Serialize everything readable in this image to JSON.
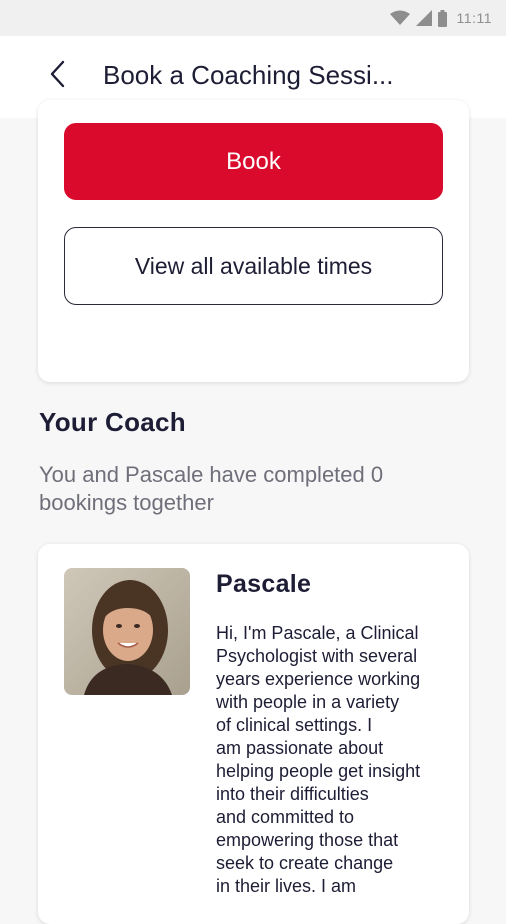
{
  "status_bar": {
    "time": "11:11",
    "icons": [
      "wifi-icon",
      "cell-signal-icon",
      "battery-icon"
    ]
  },
  "header": {
    "back_icon": "chevron-left-icon",
    "title": "Book a Coaching Sessi..."
  },
  "booking_card": {
    "book_label": "Book",
    "view_times_label": "View all available times"
  },
  "coach_section": {
    "title": "Your Coach",
    "bookings_summary": "You and Pascale have completed 0 bookings together"
  },
  "coach": {
    "name": "Pascale",
    "photo": "coach-photo",
    "bio": " Hi, I'm Pascale, a Clinical\nPsychologist with several\nyears experience working\nwith people in a variety\nof clinical settings. I\nam passionate about\nhelping people get insight\ninto their difficulties\nand committed to\nempowering those that\nseek to create change\nin their lives. I am"
  },
  "colors": {
    "accent": "#d90a2c",
    "text_primary": "#1d1d35",
    "text_secondary": "#6f6f7a",
    "background": "#f7f7f8"
  }
}
